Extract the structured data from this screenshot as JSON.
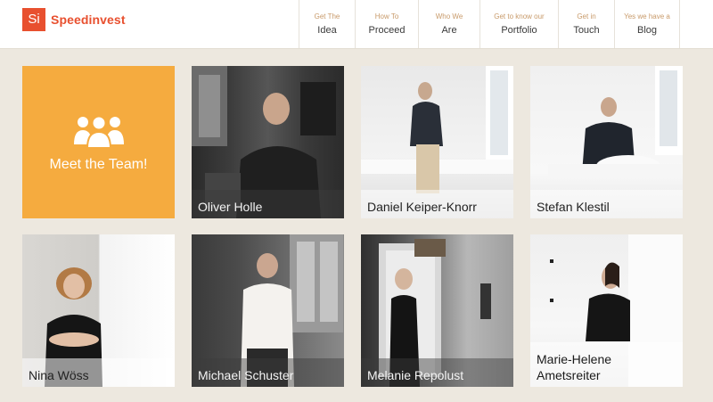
{
  "brand": {
    "logo_mark": "Si",
    "name": "Speedinvest",
    "color": "#e8502f"
  },
  "nav": [
    {
      "top": "Get The",
      "bottom": "Idea"
    },
    {
      "top": "How To",
      "bottom": "Proceed"
    },
    {
      "top": "Who We",
      "bottom": "Are"
    },
    {
      "top": "Get to know our",
      "bottom": "Portfolio"
    },
    {
      "top": "Get in",
      "bottom": "Touch"
    },
    {
      "top": "Yes we have a",
      "bottom": "Blog"
    }
  ],
  "meet_tile": {
    "label": "Meet the Team!",
    "icon": "team-icon",
    "color": "#f5ab3f"
  },
  "team": [
    {
      "name": "Oliver Holle"
    },
    {
      "name": "Daniel Keiper-Knorr"
    },
    {
      "name": "Stefan Klestil"
    },
    {
      "name": "Nina Wöss"
    },
    {
      "name": "Michael Schuster"
    },
    {
      "name": "Melanie Repolust"
    },
    {
      "name": "Marie-Helene Ametsreiter"
    }
  ]
}
